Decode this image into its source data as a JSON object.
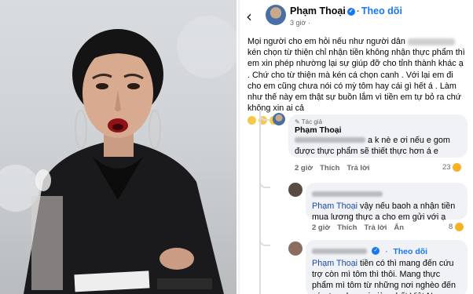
{
  "colors": {
    "facebook_blue": "#1877f2",
    "bubble": "#f0f2f5",
    "meta_gray": "#65676b"
  },
  "header": {
    "back_icon": "chevron-left-icon",
    "author": "Phạm Thoại",
    "follow_label": "Theo dõi",
    "time": "3 giờ",
    "time_icon": "globe-icon"
  },
  "post": {
    "text_before": "Mọi người cho em hỏi nếu như người dân",
    "text_after": "kén chọn từ thiện chỉ nhận tiền không nhận thực phẩm thì em xin phép nhường lại sự giúp đỡ cho tỉnh thành khác ạ . Chứ cho từ thiện mà kén cá chọn canh . Với lại em đi cho em cũng chưa nói có mỳ tôm hay cái gì hết á . Làm như thế này em thật sự buồn lắm vì tiền em tự bỏ ra chứ không xin ai cả"
  },
  "comments": [
    {
      "tag": "Tác giả",
      "author": "Phạm Thoại",
      "text_line1": "a k nè e ơi nếu e gom",
      "text_line2": "được thực phẩm sẽ thiết thực hơn á e",
      "time": "2 giờ",
      "like_label": "Thích",
      "reply_label": "Trả lời",
      "reaction_count": "23"
    },
    {
      "mention": "Phạm Thoại",
      "text_after_mention": "vậy nếu baoh a nhận tiền mua lương thực a cho em gửi với ạ",
      "time": "2 giờ",
      "like_label": "Thích",
      "reply_label": "Trả lời",
      "hide_label": "Ẩn",
      "reaction_count": "8"
    },
    {
      "follow_label": "Theo dõi",
      "mention": "Phạm Thoại",
      "text_after_mention": "tiền có thì mang đến cứu trợ còn mì tôm thì thôi. Mang thực phẩm mì tôm từ những nơi nghèo đến cứu trợ cho nơi giàu nhất Việt Nam"
    }
  ]
}
